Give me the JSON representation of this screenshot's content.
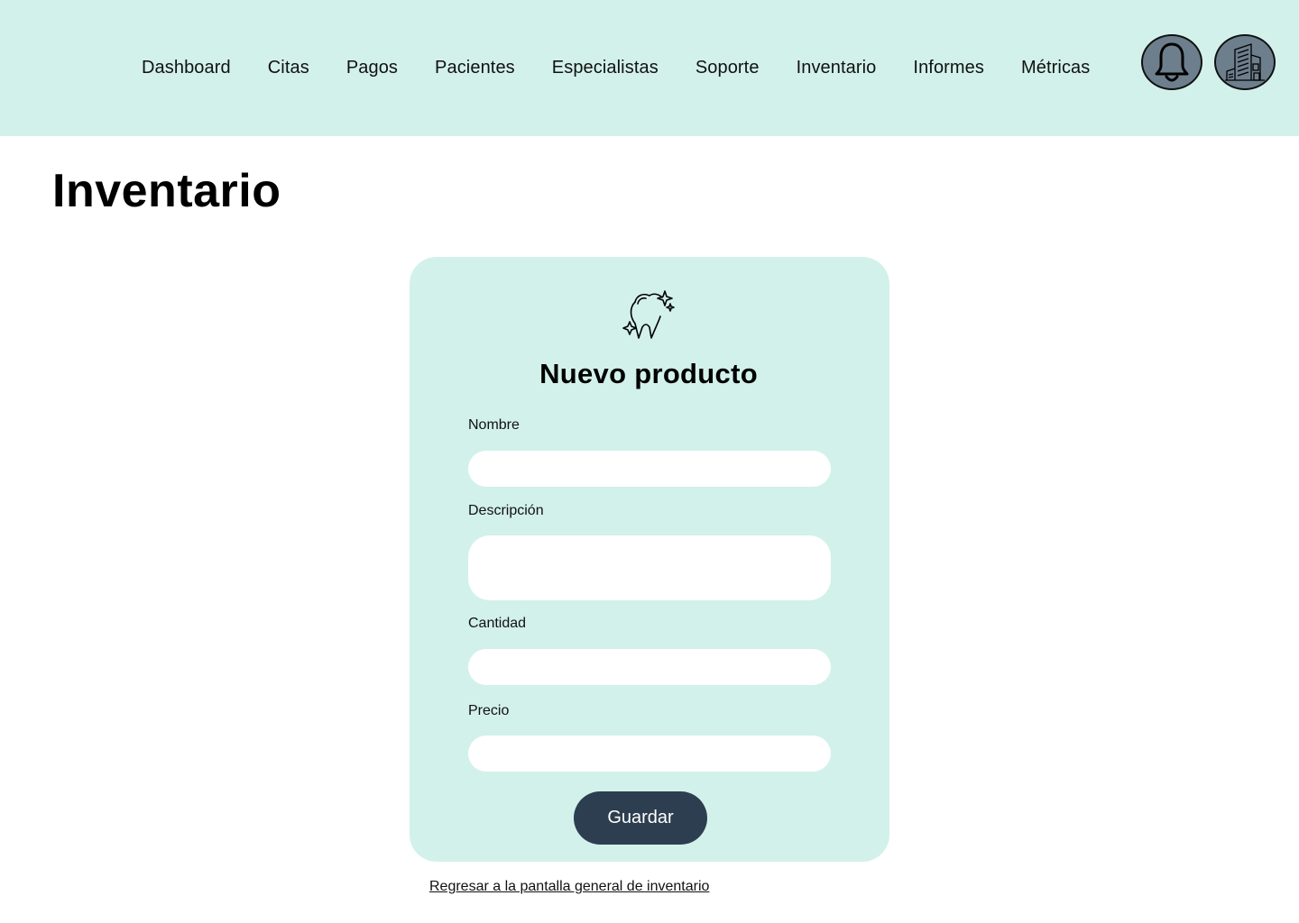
{
  "nav": {
    "items": [
      {
        "label": "Dashboard"
      },
      {
        "label": "Citas"
      },
      {
        "label": "Pagos"
      },
      {
        "label": "Pacientes"
      },
      {
        "label": "Especialistas"
      },
      {
        "label": "Soporte"
      },
      {
        "label": "Inventario"
      },
      {
        "label": "Informes"
      },
      {
        "label": "Métricas"
      }
    ],
    "icons": [
      "bell-icon",
      "building-icon"
    ]
  },
  "page": {
    "title": "Inventario"
  },
  "form": {
    "icon": "tooth-icon",
    "title": "Nuevo producto",
    "fields": {
      "nombre": {
        "label": "Nombre",
        "value": ""
      },
      "descripcion": {
        "label": "Descripción",
        "value": ""
      },
      "cantidad": {
        "label": "Cantidad",
        "value": ""
      },
      "precio": {
        "label": "Precio",
        "value": ""
      }
    },
    "save_label": "Guardar"
  },
  "footer": {
    "back_link": "Regresar a la pantalla general de inventario"
  },
  "colors": {
    "header_bg": "#d2f1ea",
    "card_bg": "#d2f1ea",
    "button_bg": "#2d3e50",
    "icon_button_bg": "#6d7f8d"
  }
}
